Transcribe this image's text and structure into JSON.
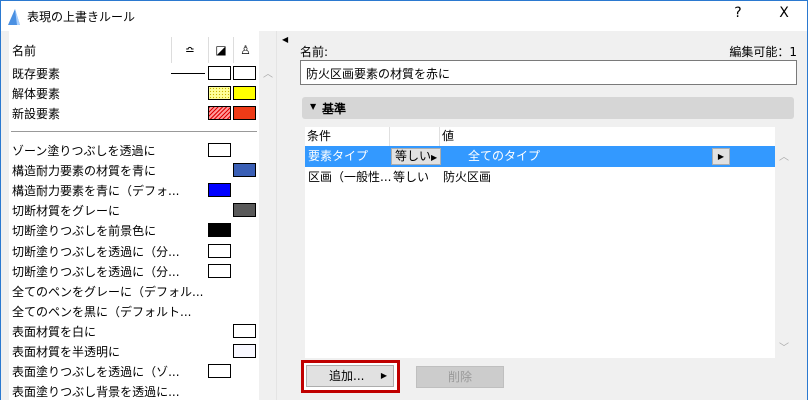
{
  "window": {
    "title": "表現の上書きルール",
    "help": "?",
    "close": "X"
  },
  "left": {
    "header": {
      "name": "名前",
      "col_line": "≏",
      "col_fill": "◪",
      "col_brush": "♙"
    },
    "top_items": [
      {
        "label": "既存要素",
        "line": true,
        "c1": "#ffffff",
        "c2": "#ffffff"
      },
      {
        "label": "解体要素",
        "c1": "#ffff99",
        "c2": "#ffff00"
      },
      {
        "label": "新設要素",
        "c1": "#ff9999",
        "c2": "#ee3b17"
      }
    ],
    "rules": [
      {
        "label": "ゾーン塗りつぶしを透過に",
        "c1": "#ffffff"
      },
      {
        "label": "構造耐力要素の材質を青に",
        "c2": "#3a5fb5"
      },
      {
        "label": "構造耐力要素を青に（デフォ...",
        "c1": "#0000ff"
      },
      {
        "label": "切断材質をグレーに",
        "c2": "#5a5a5a"
      },
      {
        "label": "切断塗りつぶしを前景色に",
        "c1": "#000000"
      },
      {
        "label": "切断塗りつぶしを透過に（分...",
        "c1": "#ffffff"
      },
      {
        "label": "切断塗りつぶしを透過に（分...",
        "c1": "#ffffff"
      },
      {
        "label": "全てのペンをグレーに（デフォル..."
      },
      {
        "label": "全てのペンを黒に（デフォルト..."
      },
      {
        "label": "表面材質を白に",
        "c2": "#ffffff"
      },
      {
        "label": "表面材質を半透明に",
        "c2": "#f8f8ff"
      },
      {
        "label": "表面塗りつぶしを透過に（ゾ...",
        "c1": "#ffffff"
      },
      {
        "label": "表面塗りつぶし背景を透過に..."
      }
    ]
  },
  "right": {
    "name_label": "名前:",
    "editable": "編集可能：1",
    "name_value": "防火区画要素の材質を赤に",
    "section": "基準",
    "table": {
      "headers": [
        "条件",
        "",
        "値"
      ],
      "rows": [
        {
          "cond": "要素タイプ",
          "op": "等しい",
          "value": "全てのタイプ",
          "selected": true
        },
        {
          "cond": "区画（一般性...",
          "op": "等しい",
          "value": "防火区画"
        }
      ]
    },
    "add": "追加...",
    "delete": "削除"
  },
  "colors": {
    "selection": "#3399ff",
    "highlight": "#c00000"
  }
}
